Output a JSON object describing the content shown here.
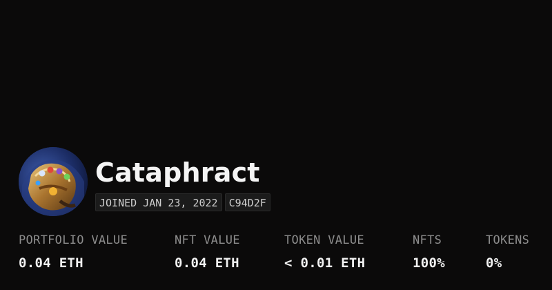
{
  "profile": {
    "name": "Cataphract",
    "avatar_icon": "gauntlet-avatar",
    "joined": "JOINED JAN 23, 2022",
    "color_code": "C94D2F"
  },
  "stats": [
    {
      "label": "PORTFOLIO VALUE",
      "value": "0.04 ETH"
    },
    {
      "label": "NFT VALUE",
      "value": "0.04 ETH"
    },
    {
      "label": "TOKEN VALUE",
      "value": "< 0.01 ETH"
    },
    {
      "label": "NFTS",
      "value": "100%"
    },
    {
      "label": "TOKENS",
      "value": "0%"
    }
  ],
  "colors": {
    "background": "#0b0a0a",
    "text": "#f2f2f2",
    "muted": "#8d8d8d",
    "tag_bg": "#1b1b1b"
  }
}
